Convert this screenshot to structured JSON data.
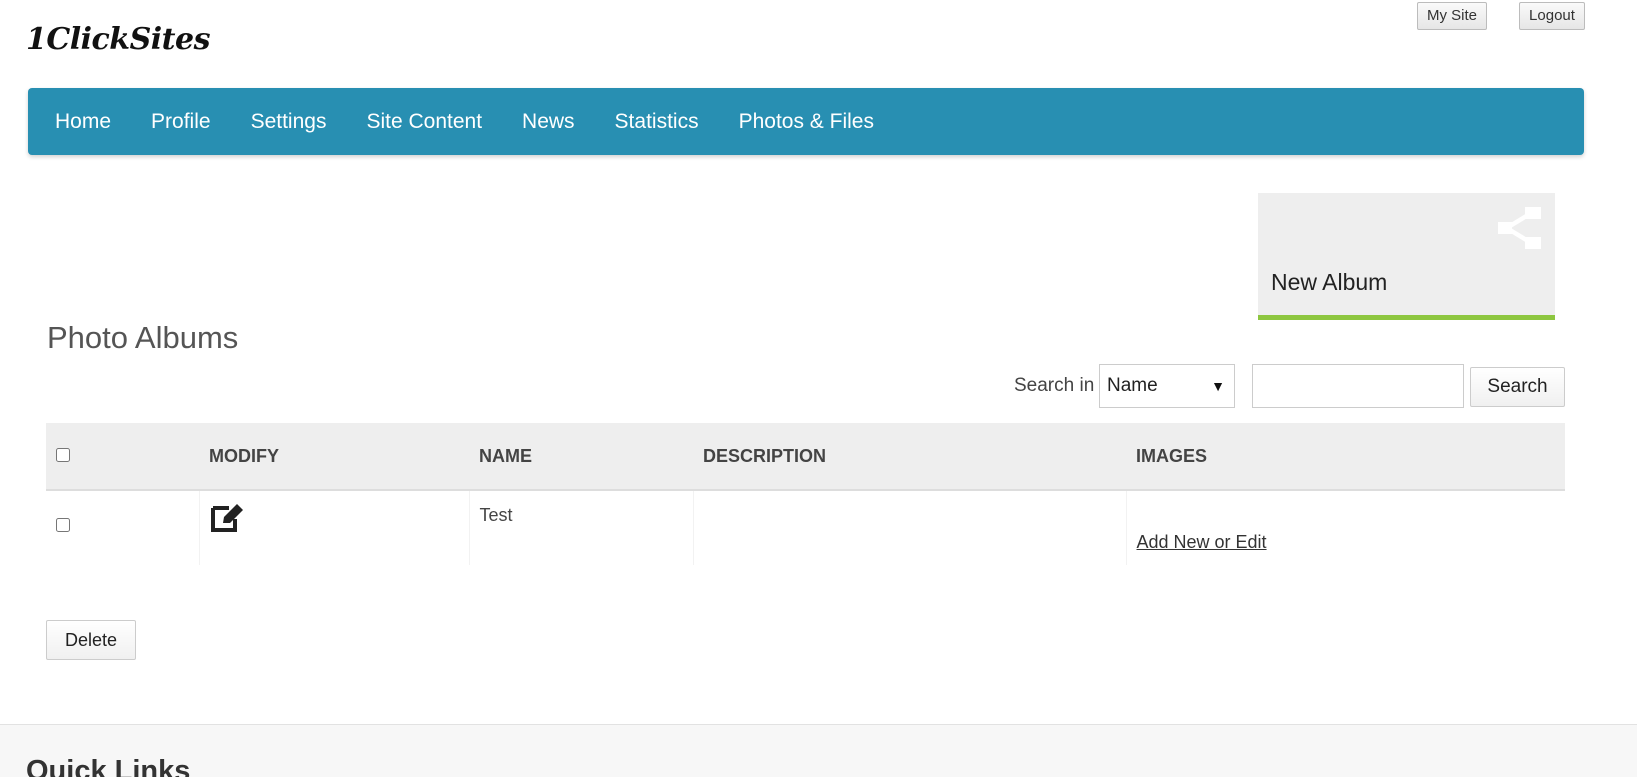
{
  "header": {
    "logo_text": "1ClickSites",
    "my_site_label": "My Site",
    "logout_label": "Logout"
  },
  "nav": {
    "items": [
      {
        "label": "Home"
      },
      {
        "label": "Profile"
      },
      {
        "label": "Settings"
      },
      {
        "label": "Site Content"
      },
      {
        "label": "News"
      },
      {
        "label": "Statistics"
      },
      {
        "label": "Photos & Files"
      }
    ]
  },
  "tile": {
    "label": "New Album",
    "icon": "share-icon",
    "accent_color": "#8dc63f"
  },
  "page": {
    "title": "Photo Albums"
  },
  "search": {
    "label": "Search in",
    "field_selected": "Name",
    "input_value": "",
    "button_label": "Search"
  },
  "table": {
    "columns": [
      "MODIFY",
      "NAME",
      "DESCRIPTION",
      "IMAGES"
    ],
    "rows": [
      {
        "name": "Test",
        "description": "",
        "images_link": "Add New or Edit",
        "modify_icon": "edit-icon"
      }
    ]
  },
  "actions": {
    "delete_label": "Delete"
  },
  "footer": {
    "title": "Quick Links"
  },
  "colors": {
    "nav_background": "#288fb2",
    "tile_background": "#eeeeee",
    "header_row_background": "#eeeeee"
  }
}
